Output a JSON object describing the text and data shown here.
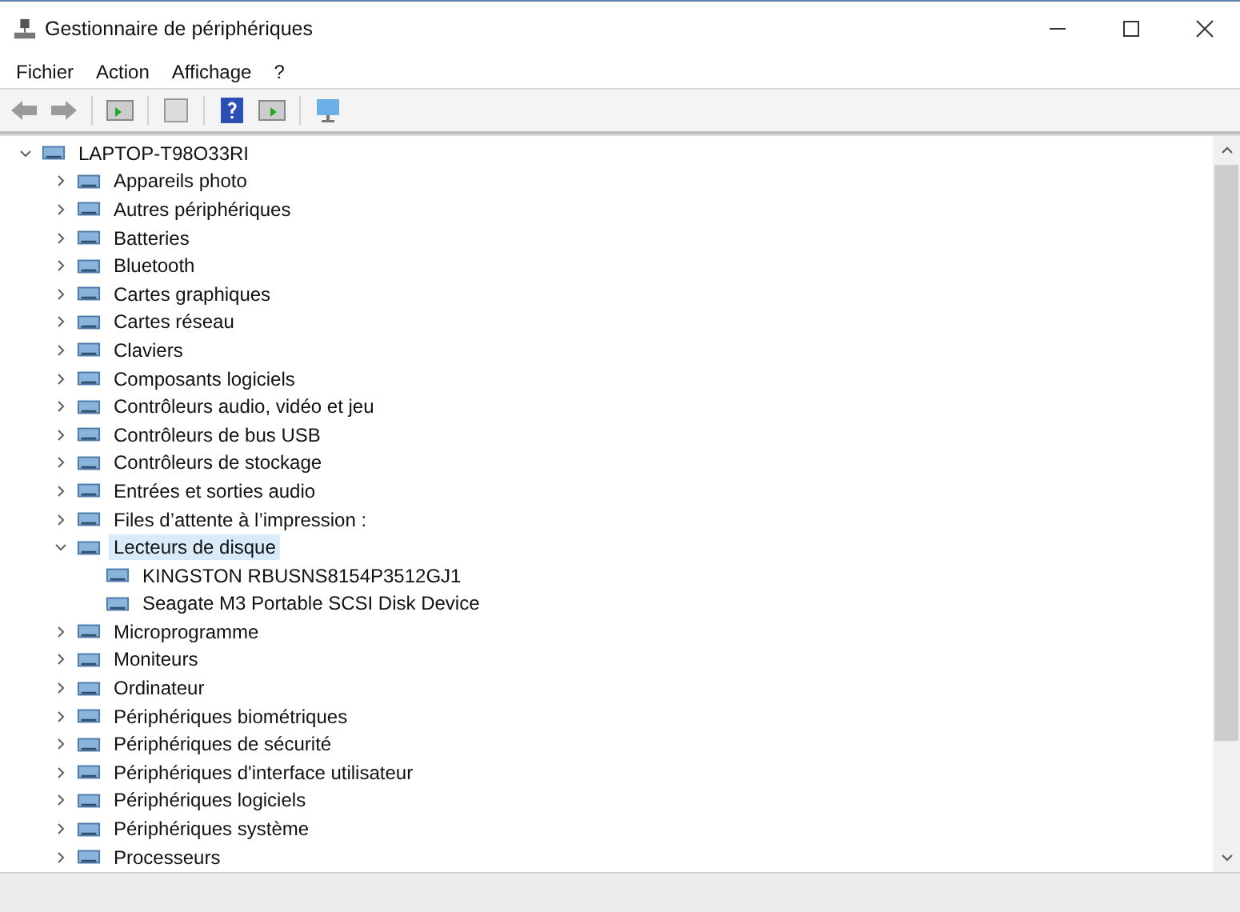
{
  "window": {
    "title": "Gestionnaire de périphériques"
  },
  "menu": [
    "Fichier",
    "Action",
    "Affichage",
    "?"
  ],
  "tree": {
    "label": "LAPTOP-T98O33RI",
    "expanded": true,
    "selected": false,
    "children": [
      {
        "label": "Appareils photo",
        "expanded": false,
        "selected": false
      },
      {
        "label": "Autres périphériques",
        "expanded": false,
        "selected": false
      },
      {
        "label": "Batteries",
        "expanded": false,
        "selected": false
      },
      {
        "label": "Bluetooth",
        "expanded": false,
        "selected": false
      },
      {
        "label": "Cartes graphiques",
        "expanded": false,
        "selected": false
      },
      {
        "label": "Cartes réseau",
        "expanded": false,
        "selected": false
      },
      {
        "label": "Claviers",
        "expanded": false,
        "selected": false
      },
      {
        "label": "Composants logiciels",
        "expanded": false,
        "selected": false
      },
      {
        "label": "Contrôleurs audio, vidéo et jeu",
        "expanded": false,
        "selected": false
      },
      {
        "label": "Contrôleurs de bus USB",
        "expanded": false,
        "selected": false
      },
      {
        "label": "Contrôleurs de stockage",
        "expanded": false,
        "selected": false
      },
      {
        "label": "Entrées et sorties audio",
        "expanded": false,
        "selected": false
      },
      {
        "label": "Files d’attente à l’impression :",
        "expanded": false,
        "selected": false
      },
      {
        "label": "Lecteurs de disque",
        "expanded": true,
        "selected": true,
        "children": [
          {
            "label": "KINGSTON RBUSNS8154P3512GJ1",
            "selected": false
          },
          {
            "label": "Seagate M3 Portable SCSI Disk Device",
            "selected": false
          }
        ]
      },
      {
        "label": "Microprogramme",
        "expanded": false,
        "selected": false
      },
      {
        "label": "Moniteurs",
        "expanded": false,
        "selected": false
      },
      {
        "label": "Ordinateur",
        "expanded": false,
        "selected": false
      },
      {
        "label": "Périphériques biométriques",
        "expanded": false,
        "selected": false
      },
      {
        "label": "Périphériques de sécurité",
        "expanded": false,
        "selected": false
      },
      {
        "label": "Périphériques d'interface utilisateur",
        "expanded": false,
        "selected": false
      },
      {
        "label": "Périphériques logiciels",
        "expanded": false,
        "selected": false
      },
      {
        "label": "Périphériques système",
        "expanded": false,
        "selected": false
      },
      {
        "label": "Processeurs",
        "expanded": false,
        "selected": false
      }
    ]
  }
}
